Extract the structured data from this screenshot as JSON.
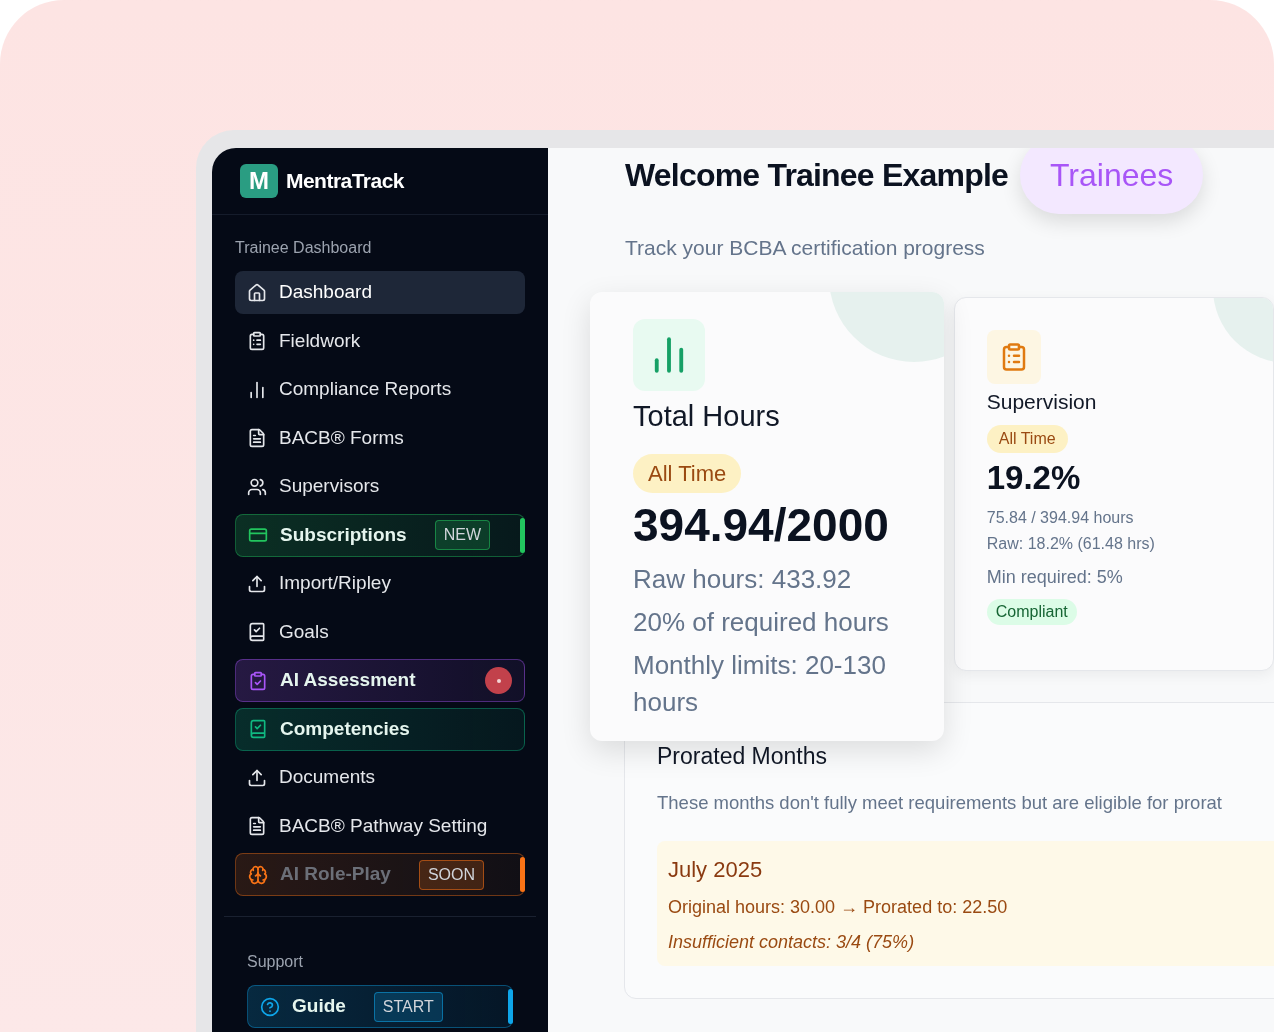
{
  "brand": {
    "name": "MentraTrack",
    "logo_letter": "M"
  },
  "sidebar": {
    "sections": [
      {
        "title": "Trainee Dashboard",
        "items": [
          {
            "label": "Dashboard",
            "kind": "link",
            "selected": true
          },
          {
            "label": "Fieldwork",
            "kind": "link",
            "selected": false
          },
          {
            "label": "Compliance Reports",
            "kind": "link",
            "selected": false
          },
          {
            "label": "BACB® Forms",
            "kind": "link",
            "selected": false
          },
          {
            "label": "Supervisors",
            "kind": "link",
            "selected": false
          },
          {
            "label": "Subscriptions",
            "kind": "featured",
            "color": "#22c55e",
            "badge": "NEW",
            "marker": true,
            "disabled": false
          },
          {
            "label": "Import/Ripley",
            "kind": "link",
            "selected": false
          },
          {
            "label": "Goals",
            "kind": "link",
            "selected": false
          },
          {
            "label": "AI Assessment",
            "kind": "featured",
            "color": "#a855f7",
            "disabled": false,
            "alert": true
          },
          {
            "label": "Competencies",
            "kind": "featured",
            "color": "#10b981",
            "disabled": false
          },
          {
            "label": "Documents",
            "kind": "link",
            "selected": false
          },
          {
            "label": "BACB® Pathway Setting",
            "kind": "link",
            "selected": false
          },
          {
            "label": "AI Role-Play",
            "kind": "featured",
            "color": "#f97316",
            "badge": "SOON",
            "marker": true,
            "disabled": true
          }
        ]
      },
      {
        "title": "Support",
        "items": [
          {
            "label": "Guide",
            "kind": "featured",
            "color": "#0ea5e9",
            "badge": "START",
            "marker": true,
            "disabled": false
          }
        ]
      }
    ]
  },
  "header": {
    "title": "Welcome Trainee Example",
    "role_badge": "Trainees",
    "subtitle": "Track your BCBA certification progress"
  },
  "cards": [
    {
      "title": "Total Hours",
      "period": "All Time",
      "value": "394.94/2000",
      "lines": [
        "Raw hours: 433.92",
        "20% of required hours",
        "Monthly limits: 20-130 hours"
      ],
      "raised": true
    },
    {
      "title": "Supervision",
      "period": "All Time",
      "value": "19.2%",
      "lines": [
        "75.84 / 394.94 hours",
        "Raw: 18.2% (61.48 hrs)",
        "Min required: 5%"
      ],
      "status": "Compliant",
      "raised": false
    }
  ],
  "prorated": {
    "title": "Prorated Months",
    "description": "These months don't fully meet requirements but are eligible for prorat",
    "months": [
      {
        "month": "July 2025",
        "detail": "Original hours: 30.00 → Prorated to: 22.50",
        "note": "Insufficient contacts: 3/4 (75%)"
      }
    ]
  }
}
